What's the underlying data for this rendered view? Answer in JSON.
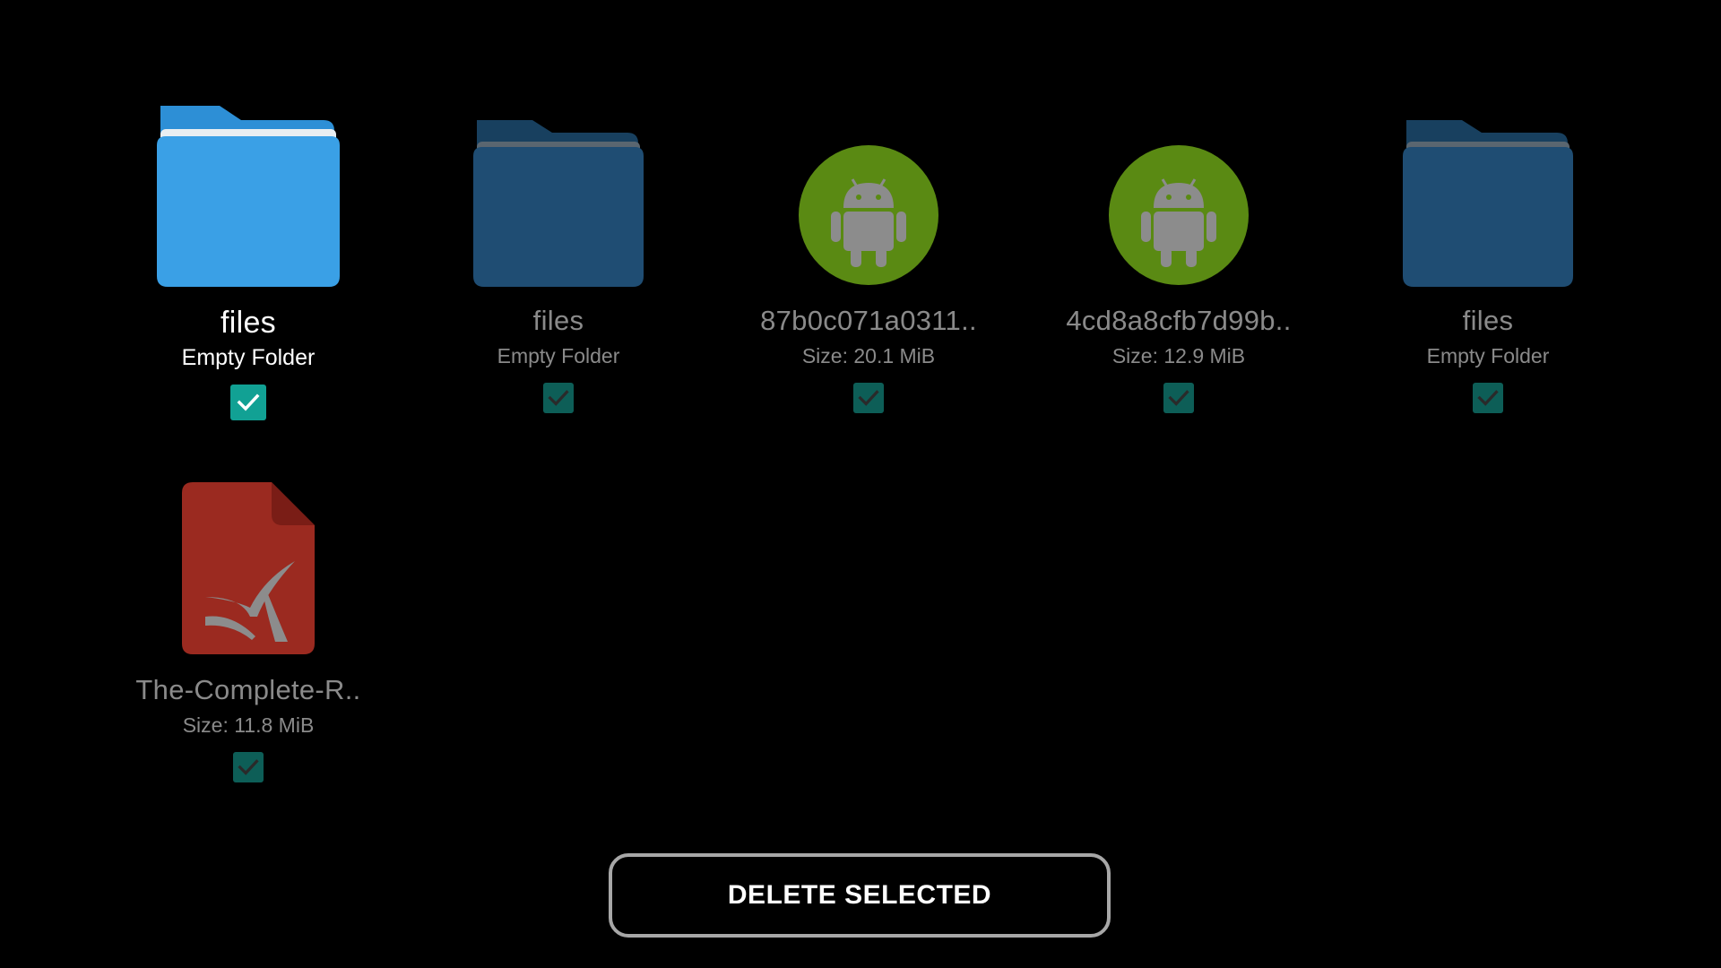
{
  "items": [
    {
      "name": "files",
      "meta": "Empty Folder",
      "icon": "folder-icon",
      "checked": true,
      "focused": true
    },
    {
      "name": "files",
      "meta": "Empty Folder",
      "icon": "folder-icon",
      "checked": true,
      "focused": false
    },
    {
      "name": "87b0c071a0311..",
      "meta": "Size: 20.1 MiB",
      "icon": "android-apk-icon",
      "checked": true,
      "focused": false
    },
    {
      "name": "4cd8a8cfb7d99b..",
      "meta": "Size: 12.9 MiB",
      "icon": "android-apk-icon",
      "checked": true,
      "focused": false
    },
    {
      "name": "files",
      "meta": "Empty Folder",
      "icon": "folder-icon",
      "checked": true,
      "focused": false
    },
    {
      "name": "The-Complete-R..",
      "meta": "Size: 11.8 MiB",
      "icon": "pdf-document-icon",
      "checked": true,
      "focused": false
    }
  ],
  "actions": {
    "delete_label": "DELETE SELECTED"
  },
  "colors": {
    "background": "#000000",
    "folder_focused": "#3aa0e6",
    "folder_dim": "#1f4d73",
    "android_circle": "#5a8a13",
    "pdf_red": "#9b2a20",
    "check_focused": "#11a194",
    "check_dim": "#0d5e57",
    "button_border": "#a7a7a7"
  }
}
